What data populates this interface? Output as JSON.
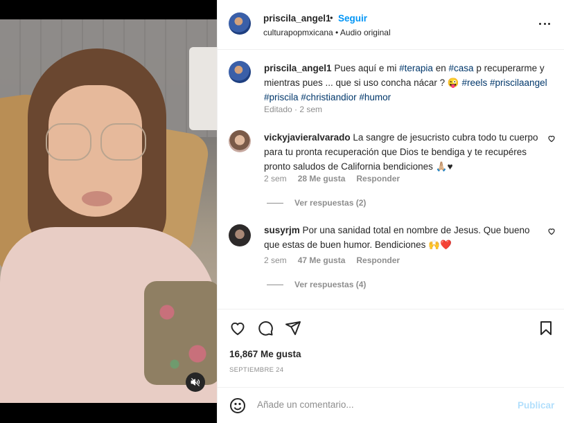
{
  "post": {
    "username": "priscila_angel1",
    "follow_label": "Seguir",
    "separator": "•",
    "subtitle": "culturapopmxicana • Audio original",
    "more_icon": "more-horizontal-icon"
  },
  "caption": {
    "username": "priscila_angel1",
    "text_1": "Pues aquí e mi",
    "tag_1": "#terapia",
    "text_2": "en",
    "tag_2": "#casa",
    "text_3": "p recuperarme y mientras pues ... que si uso concha nácar ? 😜",
    "tag_3": "#reels",
    "tag_4": "#priscilaangel",
    "tag_5": "#priscila",
    "tag_6": "#christiandior",
    "tag_7": "#humor",
    "meta": "Editado · 2 sem"
  },
  "comments": [
    {
      "username": "vickyjavieralvarado",
      "text": "La sangre de jesucristo cubra todo tu cuerpo para tu pronta recuperación que Dios te bendiga y te recupéres pronto saludos de California bendiciones 🙏🏼♥",
      "time": "2 sem",
      "likes": "28 Me gusta",
      "reply": "Responder",
      "view_replies": "Ver respuestas (2)"
    },
    {
      "username": "susyrjm",
      "text": "Por una sanidad total en nombre de Jesus. Que bueno que estas de buen humor. Bendiciones 🙌❤️",
      "time": "2 sem",
      "likes": "47 Me gusta",
      "reply": "Responder",
      "view_replies": "Ver respuestas (4)"
    }
  ],
  "footer": {
    "likes": "16,867 Me gusta",
    "date": "SEPTIEMBRE 24",
    "comment_placeholder": "Añade un comentario...",
    "publish_label": "Publicar"
  },
  "colors": {
    "accent": "#0095f6",
    "hashtag": "#00376b",
    "muted": "#8e8e8e",
    "publish_disabled": "#b2dffc"
  }
}
